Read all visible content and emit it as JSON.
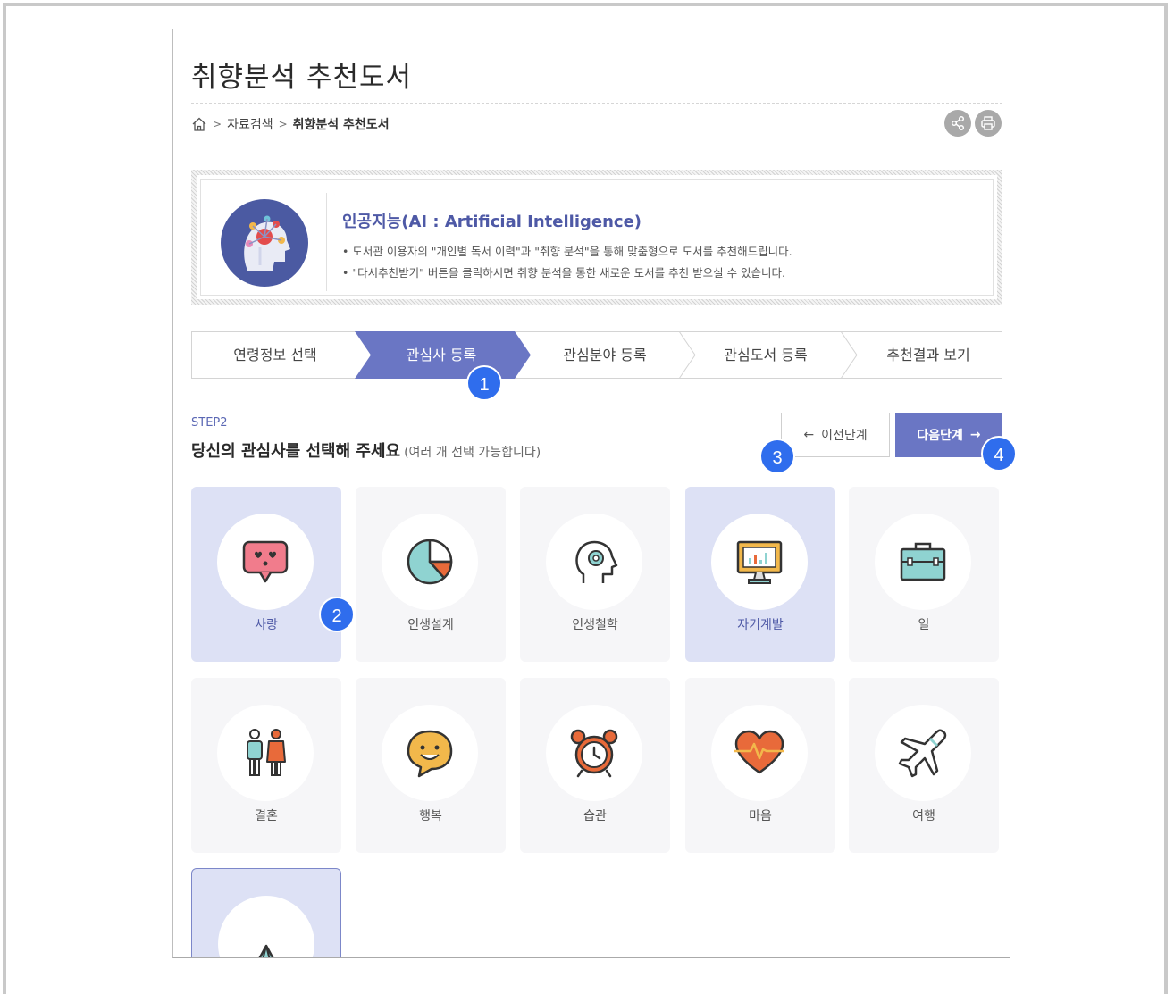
{
  "page": {
    "title": "취향분석 추천도서"
  },
  "breadcrumb": {
    "home_icon": "home-icon",
    "sep1": ">",
    "item1": "자료검색",
    "sep2": ">",
    "current": "취향분석 추천도서"
  },
  "actions": {
    "share_icon": "share-icon",
    "print_icon": "print-icon"
  },
  "ai_intro": {
    "icon": "ai-head-icon",
    "title": "인공지능(AI : Artificial Intelligence)",
    "line1": "• 도서관 이용자의 \"개인별 독서 이력\"과 \"취향 분석\"을 통해 맞춤형으로 도서를 추천해드립니다.",
    "line2": "• \"다시추천받기\" 버튼을 클릭하시면 취향 분석을 통한 새로운 도서를 추천 받으실 수 있습니다."
  },
  "steps": [
    {
      "label": "연령정보 선택",
      "active": false
    },
    {
      "label": "관심사 등록",
      "active": true
    },
    {
      "label": "관심분야 등록",
      "active": false
    },
    {
      "label": "관심도서 등록",
      "active": false
    },
    {
      "label": "추천결과 보기",
      "active": false
    }
  ],
  "content": {
    "step_number": "STEP2",
    "heading": "당신의 관심사를 선택해 주세요",
    "heading_sub": "(여러 개 선택 가능합니다)",
    "prev_label": "이전단계",
    "prev_arrow": "←",
    "next_label": "다음단계",
    "next_arrow": "→"
  },
  "interests": [
    {
      "label": "사랑",
      "icon": "love-chat-icon",
      "selected": true
    },
    {
      "label": "인생설계",
      "icon": "pie-chart-icon",
      "selected": false
    },
    {
      "label": "인생철학",
      "icon": "head-gear-icon",
      "selected": false
    },
    {
      "label": "자기계발",
      "icon": "monitor-chart-icon",
      "selected": true
    },
    {
      "label": "일",
      "icon": "briefcase-icon",
      "selected": false
    },
    {
      "label": "결혼",
      "icon": "couple-icon",
      "selected": false
    },
    {
      "label": "행복",
      "icon": "smile-icon",
      "selected": false
    },
    {
      "label": "습관",
      "icon": "alarm-clock-icon",
      "selected": false
    },
    {
      "label": "마음",
      "icon": "heart-pulse-icon",
      "selected": false
    },
    {
      "label": "여행",
      "icon": "airplane-icon",
      "selected": false
    },
    {
      "label": "",
      "icon": "tent-icon",
      "selected": true
    }
  ],
  "annotations": [
    "1",
    "2",
    "3",
    "4"
  ],
  "colors": {
    "accent": "#6a76c4",
    "selected_bg": "#dde1f5",
    "badge": "#2f6ded",
    "title_accent": "#4e59a6"
  }
}
